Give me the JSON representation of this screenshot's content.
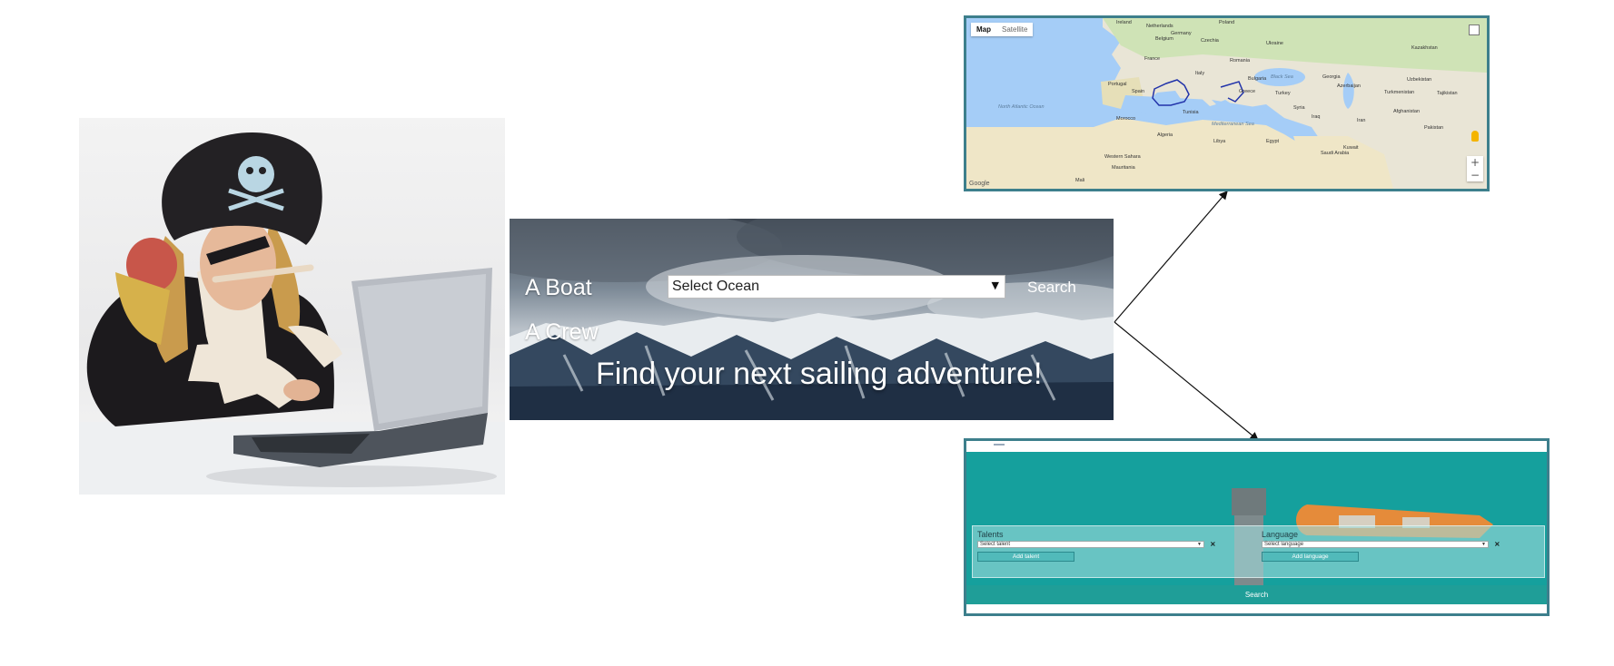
{
  "hero": {
    "brand_boat": "A Boat",
    "brand_crew": "A Crew",
    "ocean_select": {
      "value": "Select Ocean"
    },
    "search_label": "Search",
    "tagline": "Find your next sailing adventure!"
  },
  "map": {
    "map_type": [
      "Map",
      "Satellite"
    ],
    "zoom": [
      "+",
      "−"
    ],
    "attribution": "Google",
    "country_labels": [
      "Ireland",
      "Netherlands",
      "Germany",
      "Poland",
      "Belgium",
      "Czechia",
      "Ukraine",
      "France",
      "Romania",
      "Kazakhstan",
      "Portugal",
      "Spain",
      "Italy",
      "Bulgaria",
      "Greece",
      "Turkey",
      "Georgia",
      "Azerbaijan",
      "Uzbekistan",
      "Turkmenistan",
      "Tajikistan",
      "Morocco",
      "Algeria",
      "Tunisia",
      "Libya",
      "Egypt",
      "Syria",
      "Iraq",
      "Iran",
      "Afghanistan",
      "Pakistan",
      "Saudi Arabia",
      "Mauritania",
      "Western Sahara",
      "Kuwait",
      "Mali"
    ],
    "sea_labels": [
      "North Atlantic Ocean",
      "Mediterranean Sea",
      "Black Sea"
    ]
  },
  "crew": {
    "talents_label": "Talents",
    "talent_select": "Select talent",
    "add_talent": "Add talent",
    "language_label": "Language",
    "language_select": "Select language",
    "add_language": "Add language",
    "remove_glyph": "×",
    "search_label": "Search"
  },
  "colors": {
    "frame_border": "#3d7f8c",
    "teal_bar": "#1f9e98",
    "route": "#2233aa"
  },
  "icons": [
    "fullscreen-icon",
    "pegman-icon",
    "zoom-in-icon",
    "zoom-out-icon",
    "select-caret-icon",
    "remove-icon"
  ]
}
